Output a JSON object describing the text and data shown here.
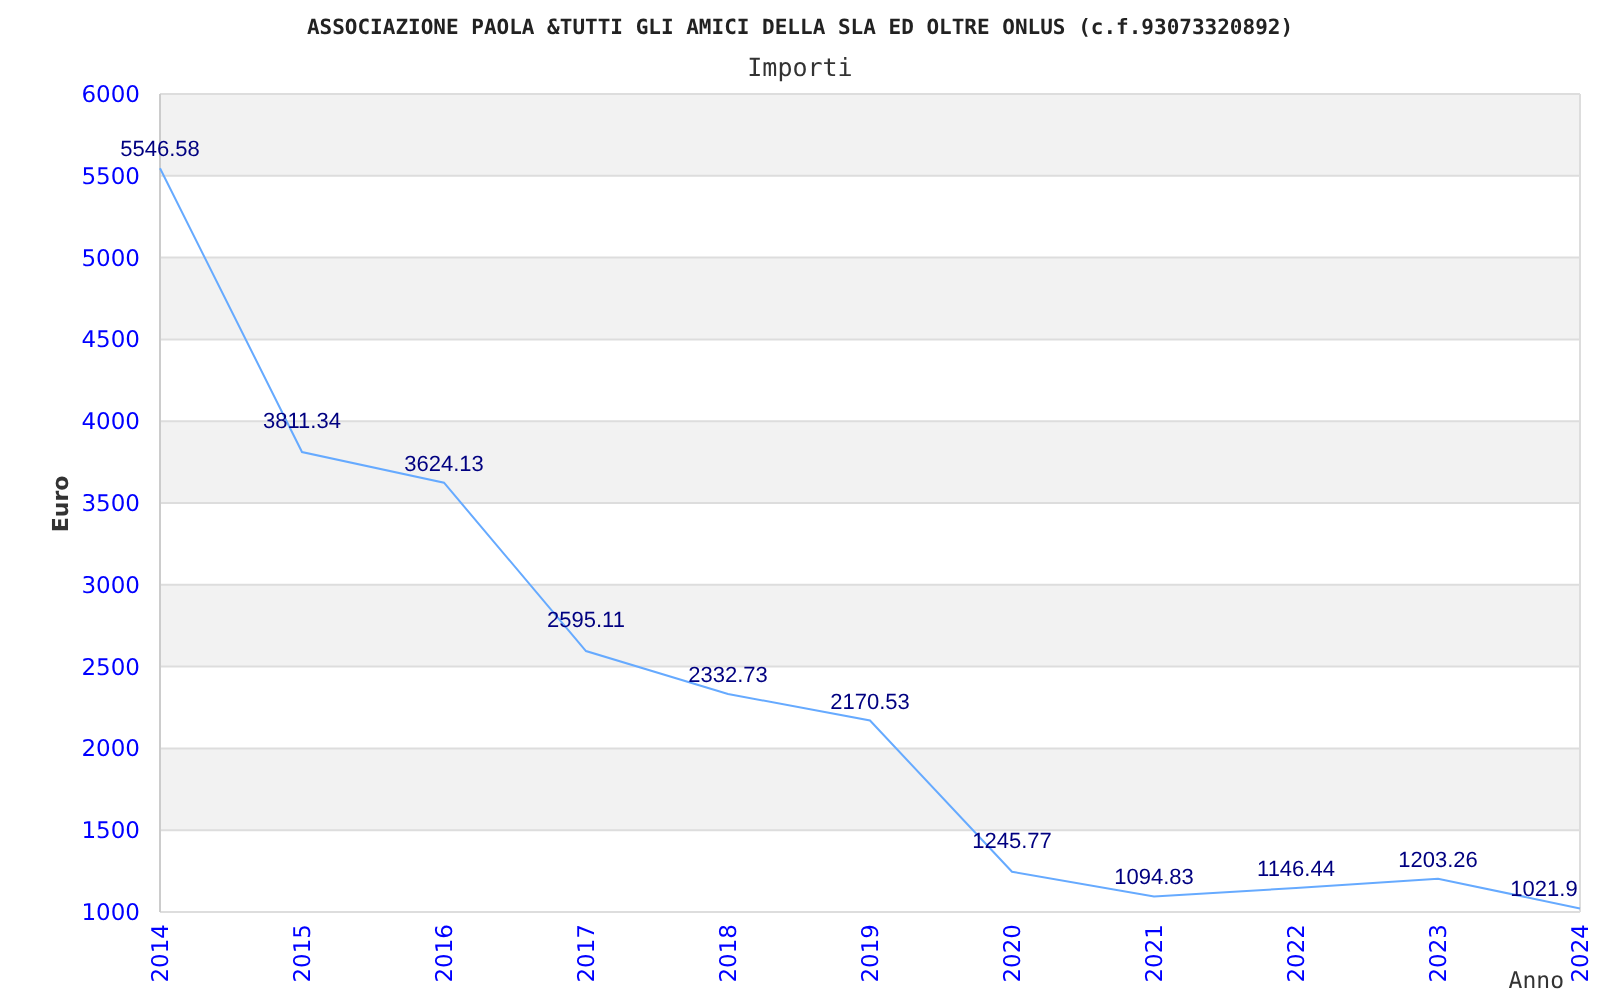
{
  "chart": {
    "title": "ASSOCIAZIONE PAOLA &TUTTI GLI AMICI DELLA SLA ED OLTRE ONLUS (c.f.93073320892)",
    "chart_data": {
      "type": "line",
      "title": "Importi",
      "xlabel": "Anno",
      "ylabel": "Euro",
      "categories": [
        "2014",
        "2015",
        "2016",
        "2017",
        "2018",
        "2019",
        "2020",
        "2021",
        "2022",
        "2023",
        "2024"
      ],
      "grid": true,
      "series": [
        {
          "color": "#66aaff",
          "values": [
            5546.58,
            3811.34,
            3624.13,
            2595.11,
            2332.73,
            2170.53,
            1245.77,
            1094.83,
            1146.44,
            1203.26,
            1021.9
          ]
        }
      ],
      "ylim": [
        1000,
        6000
      ],
      "yticks": [
        1000,
        1500,
        2000,
        2500,
        3000,
        3500,
        4000,
        4500,
        5000,
        5500,
        6000
      ],
      "value_labels": [
        "5546.58",
        "3811.34",
        "3624.13",
        "2595.11",
        "2332.73",
        "2170.53",
        "1245.77",
        "1094.83",
        "1146.44",
        "1203.26",
        "1021.9"
      ]
    }
  }
}
